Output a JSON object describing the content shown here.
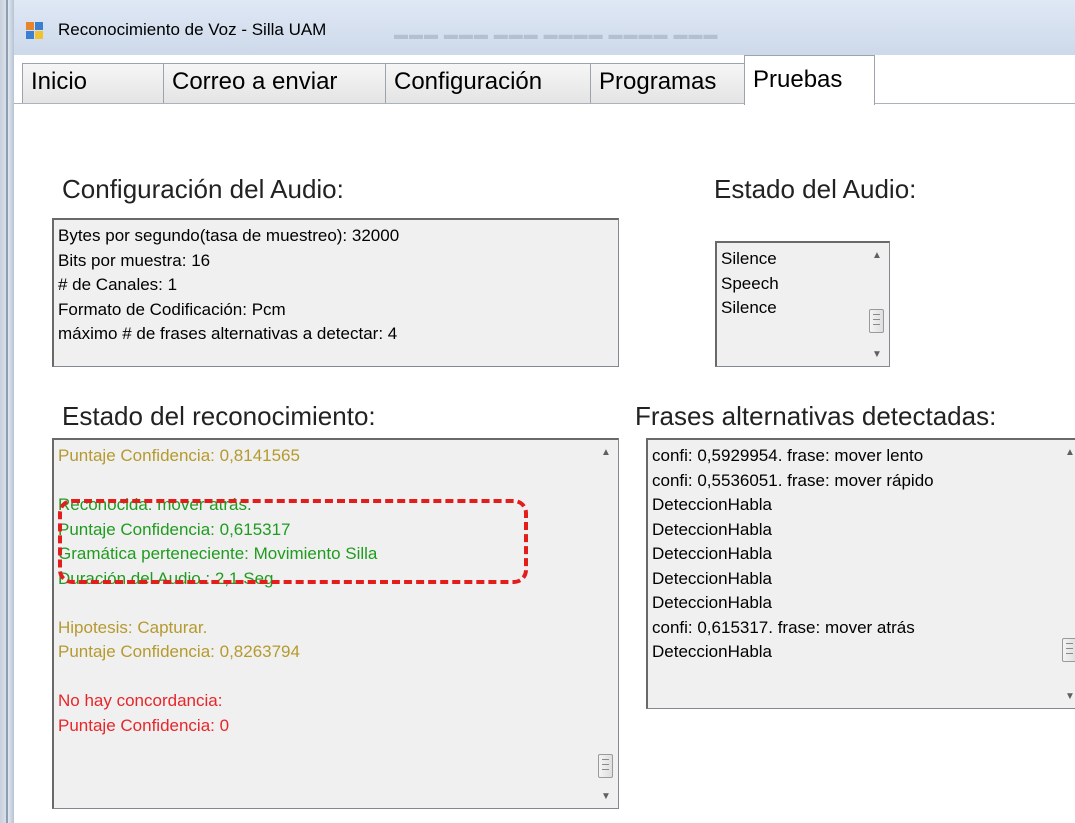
{
  "window": {
    "title": "Reconocimiento de Voz - Silla UAM"
  },
  "tabs": [
    {
      "label": "Inicio"
    },
    {
      "label": "Correo a enviar"
    },
    {
      "label": "Configuración"
    },
    {
      "label": "Programas"
    },
    {
      "label": "Pruebas"
    }
  ],
  "active_tab": "Pruebas",
  "audio_config": {
    "heading": "Configuración del Audio:",
    "lines": [
      "Bytes por segundo(tasa de muestreo): 32000",
      "Bits por muestra: 16",
      "# de Canales: 1",
      "Formato de Codificación: Pcm",
      "máximo # de frases alternativas a detectar: 4"
    ]
  },
  "audio_state": {
    "heading": "Estado del Audio:",
    "items": [
      "Silence",
      "Speech",
      "Silence"
    ]
  },
  "recognition": {
    "heading": "Estado del reconocimiento:",
    "lines": [
      {
        "text": "Puntaje Confidencia: 0,8141565",
        "color": "#b59a2e"
      },
      {
        "text": "",
        "color": "#000000"
      },
      {
        "text": "Reconocida: mover atrás.",
        "color": "#1f9c1f"
      },
      {
        "text": "Puntaje Confidencia: 0,615317",
        "color": "#1f9c1f"
      },
      {
        "text": "Gramática perteneciente: Movimiento Silla",
        "color": "#1f9c1f"
      },
      {
        "text": "Duración del Audio : 2,1 Seg",
        "color": "#1f9c1f"
      },
      {
        "text": "",
        "color": "#000000"
      },
      {
        "text": "Hipotesis: Capturar.",
        "color": "#b59a2e"
      },
      {
        "text": "Puntaje Confidencia: 0,8263794",
        "color": "#b59a2e"
      },
      {
        "text": "",
        "color": "#000000"
      },
      {
        "text": "No hay concordancia:",
        "color": "#e8262a"
      },
      {
        "text": "Puntaje Confidencia: 0",
        "color": "#e8262a"
      }
    ]
  },
  "alternatives": {
    "heading": "Frases alternativas detectadas:",
    "lines": [
      "confi:  0,5929954.  frase: mover lento",
      "confi:  0,5536051.  frase: mover rápido",
      "DeteccionHabla",
      "DeteccionHabla",
      "DeteccionHabla",
      "DeteccionHabla",
      "DeteccionHabla",
      "confi:  0,615317.  frase: mover atrás",
      "DeteccionHabla"
    ]
  },
  "colors": {
    "hypothesis": "#b59a2e",
    "recognized": "#1f9c1f",
    "no_match": "#e8262a",
    "highlight": "#e31c1c",
    "titlebar": "#cdd9ea"
  },
  "icons": [
    "app-icon",
    "scroll-up-arrow-icon",
    "scroll-down-arrow-icon",
    "scroll-thumb-grip-icon"
  ]
}
